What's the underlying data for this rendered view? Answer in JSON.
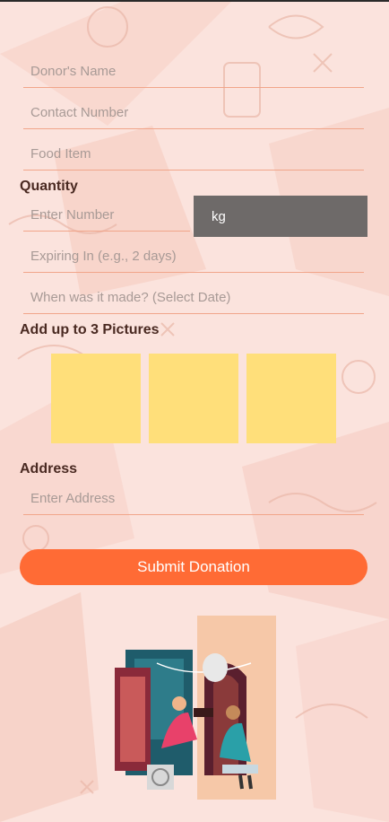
{
  "form": {
    "donor_name_placeholder": "Donor's Name",
    "contact_placeholder": "Contact Number",
    "food_item_placeholder": "Food Item",
    "quantity_label": "Quantity",
    "quantity_placeholder": "Enter Number",
    "unit_value": "kg",
    "expiry_placeholder": "Expiring In (e.g., 2 days)",
    "made_date_placeholder": "When was it made? (Select Date)",
    "pictures_label": "Add up to 3 Pictures",
    "address_label": "Address",
    "address_placeholder": "Enter Address",
    "submit_label": "Submit Donation"
  },
  "colors": {
    "background": "#fbe3dd",
    "accent": "#ff6b35",
    "picture_slot": "#ffdf7a",
    "unit_select": "#6e6a69",
    "underline": "#f1a58a"
  },
  "icons": [
    "food-doodle-pattern",
    "food-handover-illustration"
  ]
}
